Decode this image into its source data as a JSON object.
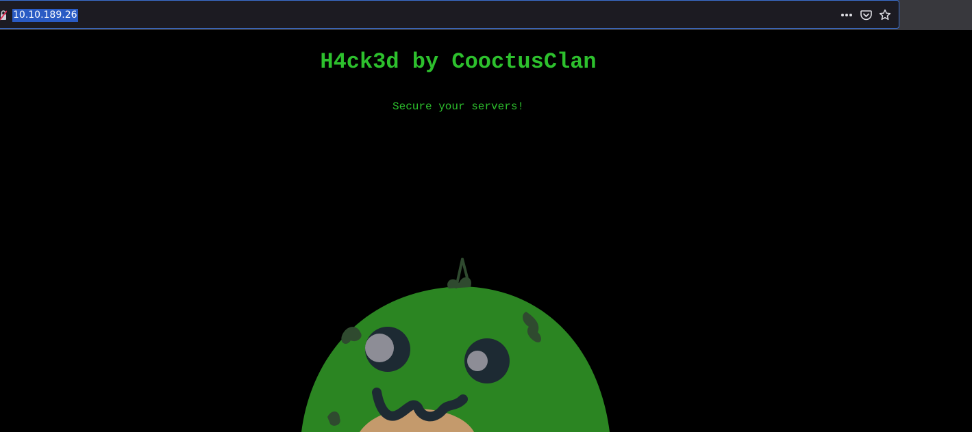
{
  "browser": {
    "url": "10.10.189.26",
    "icons": {
      "security": "insecure-connection-icon",
      "more": "more-actions-icon",
      "pocket": "pocket-icon",
      "bookmark": "bookmark-star-icon"
    },
    "colors": {
      "url_selection": "#2a5bc4",
      "focus_border": "#3b6fd0"
    }
  },
  "page": {
    "title": "H4ck3d by CooctusClan",
    "subtitle": "Secure your servers!",
    "colors": {
      "text": "#2dc02d",
      "background": "#000000",
      "cactus": "#2b8522"
    }
  }
}
